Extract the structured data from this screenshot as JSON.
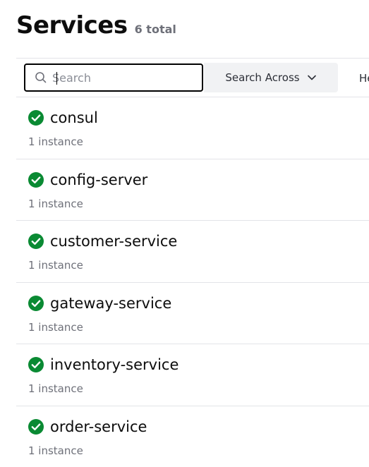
{
  "header": {
    "title": "Services",
    "total": "6 total"
  },
  "toolbar": {
    "search_placeholder": "Search",
    "search_value": "",
    "search_across_label": "Search Across",
    "truncated_label": "He"
  },
  "colors": {
    "healthy": "#0a8a33"
  },
  "services": [
    {
      "name": "consul",
      "instances": "1 instance",
      "status": "passing"
    },
    {
      "name": "config-server",
      "instances": "1 instance",
      "status": "passing"
    },
    {
      "name": "customer-service",
      "instances": "1 instance",
      "status": "passing"
    },
    {
      "name": "gateway-service",
      "instances": "1 instance",
      "status": "passing"
    },
    {
      "name": "inventory-service",
      "instances": "1 instance",
      "status": "passing"
    },
    {
      "name": "order-service",
      "instances": "1 instance",
      "status": "passing"
    }
  ]
}
